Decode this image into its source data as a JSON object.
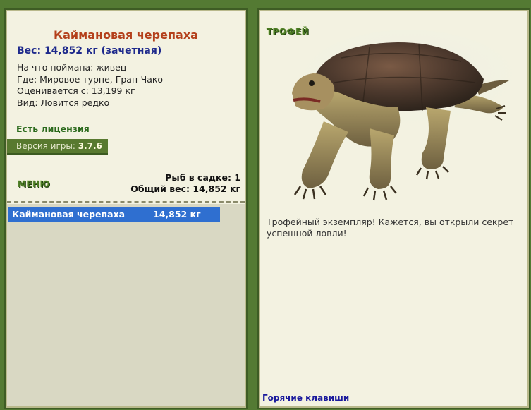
{
  "catch": {
    "fish_name": "Каймановая черепаха",
    "weight_line": "Вес: 14,852 кг (зачетная)",
    "bait": "На что поймана: живец",
    "location": "Где: Мировое турне, Гран-Чако",
    "rated_from": "Оценивается с: 13,199 кг",
    "rarity": "Вид: Ловится редко"
  },
  "license": "Есть лицензия",
  "version": {
    "label": "Версия игры:",
    "value": "3.7.6"
  },
  "menu_label": "МЕНЮ",
  "keepnet": {
    "count_line": "Рыб в садке: 1",
    "total_line": "Общий вес: 14,852 кг",
    "rows": [
      {
        "name": "Каймановая черепаха",
        "weight": "14,852 кг"
      }
    ]
  },
  "trophy": {
    "label": "ТРОФЕЙ",
    "message": "Трофейный экземпляр! Кажется, вы открыли секрет успешной ловли!"
  },
  "hotkeys_label": "Горячие клавиши",
  "colors": {
    "background": "#547a33",
    "panel": "#f3f2e1",
    "fish_name": "#b4401b",
    "weight": "#1e2a8c",
    "selected_row": "#2f6fd0"
  }
}
